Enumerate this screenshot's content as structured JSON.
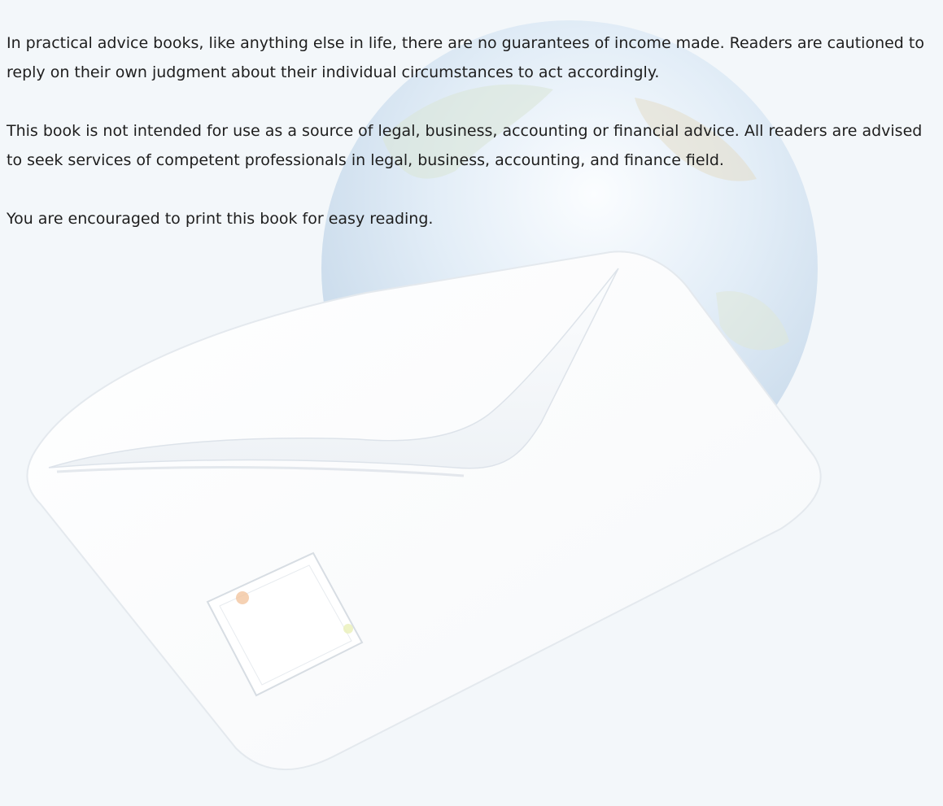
{
  "document": {
    "paragraphs": [
      "In practical advice books, like anything else in life, there are no guarantees of income made. Readers are cautioned to reply on their own judgment about their individual circumstances to act accordingly.",
      "This book is not intended for use as a source of legal, business, accounting or financial advice. All readers are advised to seek services of competent professionals in legal, business, accounting, and finance field.",
      "You are encouraged to print this book for easy reading."
    ]
  },
  "background": {
    "page_color": "#f3f7fa",
    "watermark_icons": [
      "globe-icon",
      "envelope-icon",
      "postage-stamp-icon"
    ]
  }
}
